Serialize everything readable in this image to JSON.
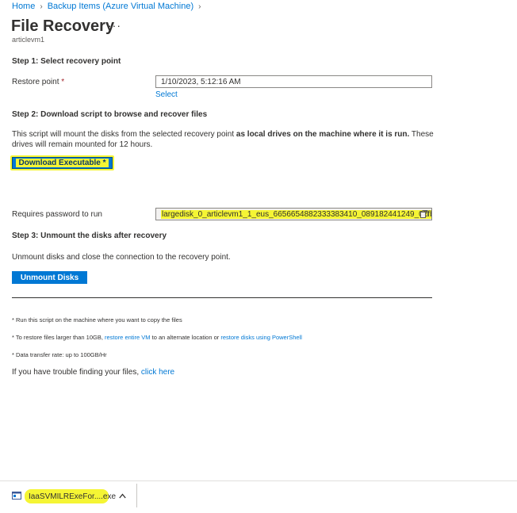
{
  "breadcrumb": {
    "home": "Home",
    "backup_items": "Backup Items (Azure Virtual Machine)"
  },
  "header": {
    "title": "File Recovery",
    "more": "···",
    "subtitle": "articlevm1"
  },
  "step1": {
    "heading": "Step 1: Select recovery point",
    "restore_label": "Restore point",
    "required_mark": "*",
    "restore_value": "1/10/2023, 5:12:16 AM",
    "select_link": "Select"
  },
  "step2": {
    "heading": "Step 2: Download script to browse and recover files",
    "desc_pre": "This script will mount the disks from the selected recovery point ",
    "desc_bold": "as local drives on the machine where it is run.",
    "desc_post": " These drives will remain mounted for 12 hours.",
    "download_button": "Download Executable *",
    "password_label": "Requires password to run",
    "password_value": "largedisk_0_articlevm1_1_eus_6656654882333383410_089182441249_07fba..."
  },
  "step3": {
    "heading": "Step 3: Unmount the disks after recovery",
    "desc": "Unmount disks and close the connection to the recovery point.",
    "unmount_button": "Unmount Disks"
  },
  "notes": {
    "note1": "* Run this script on the machine where you want to copy the files",
    "note2_pre": "* To restore files larger than 10GB, ",
    "note2_link1": "restore entire VM",
    "note2_mid": " to an alternate location or ",
    "note2_link2": "restore disks using PowerShell",
    "note3": "* Data transfer rate: up to 100GB/Hr",
    "trouble_pre": "If you have trouble finding your files, ",
    "trouble_link": "click here"
  },
  "download_bar": {
    "file_name": "IaaSVMILRExeFor....exe",
    "file_icon": "executable-file-icon",
    "menu_icon": "chevron-up-icon"
  },
  "colors": {
    "accent": "#0078d4",
    "highlight": "#f5f534",
    "text": "#323130"
  }
}
